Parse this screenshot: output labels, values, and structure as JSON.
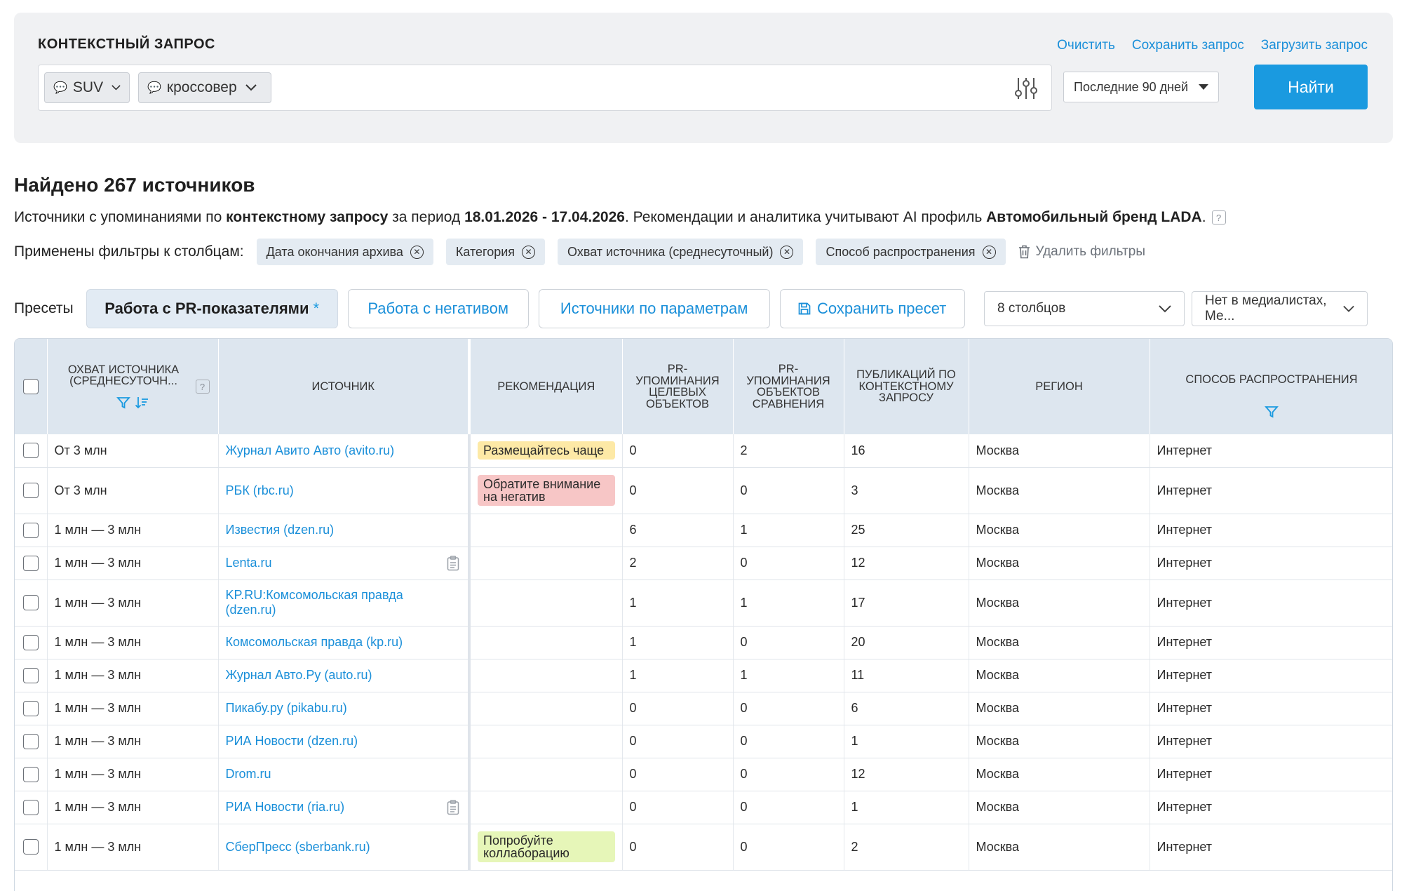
{
  "query": {
    "title": "КОНТЕКСТНЫЙ ЗАПРОС",
    "actions": [
      "Очистить",
      "Сохранить запрос",
      "Загрузить запрос"
    ],
    "chips": [
      "SUV",
      "кроссовер"
    ],
    "period": "Последние 90 дней",
    "find_label": "Найти"
  },
  "results": {
    "title": "Найдено 267 источников",
    "desc_1": "Источники с упоминаниями по ",
    "desc_bold_1": "контекстному запросу",
    "desc_2": " за период ",
    "desc_bold_2": "18.01.2026 - 17.04.2026",
    "desc_3": ". Рекомендации и аналитика учитывают AI профиль ",
    "desc_bold_3": "Автомобильный бренд LADA",
    "desc_4": ".",
    "help": "?",
    "filters_label": "Применены фильтры к столбцам:",
    "filters": [
      "Дата окончания архива",
      "Категория",
      "Охват источника (среднесуточный)",
      "Способ распространения"
    ],
    "delete_filters": "Удалить фильтры"
  },
  "presets": {
    "label": "Пресеты",
    "active": "Работа с PR-показателями",
    "active_mark": "*",
    "items": [
      "Работа с негативом",
      "Источники по параметрам"
    ],
    "save": "Сохранить пресет",
    "columns": "8 столбцов",
    "media": "Нет в медиалистах, Ме..."
  },
  "table": {
    "headers": {
      "reach": "Охват источника (среднесуточн...",
      "source": "Источник",
      "recommendation": "Рекомендация",
      "pr_target": "PR-упоминания целевых объектов",
      "pr_compare": "PR-упоминания объектов сравнения",
      "publications": "Публикаций по контекстному запросу",
      "region": "Регион",
      "distribution": "Способ распространения"
    },
    "rows": [
      {
        "reach": "От 3 млн",
        "source": "Журнал Авито Авто (avito.ru)",
        "rec": "Размещайтесь чаще",
        "rec_color": "yellow",
        "pr_t": "0",
        "pr_c": "2",
        "pub": "16",
        "region": "Москва",
        "dist": "Интернет"
      },
      {
        "reach": "От 3 млн",
        "source": "РБК (rbc.ru)",
        "rec": "Обратите внимание на негатив",
        "rec_color": "red",
        "pr_t": "0",
        "pr_c": "0",
        "pub": "3",
        "region": "Москва",
        "dist": "Интернет"
      },
      {
        "reach": "1 млн — 3 млн",
        "source": "Известия (dzen.ru)",
        "rec": "",
        "pr_t": "6",
        "pr_c": "1",
        "pub": "25",
        "region": "Москва",
        "dist": "Интернет"
      },
      {
        "reach": "1 млн — 3 млн",
        "source": "Lenta.ru",
        "rec": "",
        "pr_t": "2",
        "pr_c": "0",
        "pub": "12",
        "region": "Москва",
        "dist": "Интернет"
      },
      {
        "reach": "1 млн — 3 млн",
        "source": "KP.RU:Комсомольская правда (dzen.ru)",
        "rec": "",
        "pr_t": "1",
        "pr_c": "1",
        "pub": "17",
        "region": "Москва",
        "dist": "Интернет"
      },
      {
        "reach": "1 млн — 3 млн",
        "source": "Комсомольская правда (kp.ru)",
        "rec": "",
        "pr_t": "1",
        "pr_c": "0",
        "pub": "20",
        "region": "Москва",
        "dist": "Интернет"
      },
      {
        "reach": "1 млн — 3 млн",
        "source": "Журнал Авто.Ру (auto.ru)",
        "rec": "",
        "pr_t": "1",
        "pr_c": "1",
        "pub": "11",
        "region": "Москва",
        "dist": "Интернет"
      },
      {
        "reach": "1 млн — 3 млн",
        "source": "Пикабу.ру (pikabu.ru)",
        "rec": "",
        "pr_t": "0",
        "pr_c": "0",
        "pub": "6",
        "region": "Москва",
        "dist": "Интернет"
      },
      {
        "reach": "1 млн — 3 млн",
        "source": "РИА Новости (dzen.ru)",
        "rec": "",
        "pr_t": "0",
        "pr_c": "0",
        "pub": "1",
        "region": "Москва",
        "dist": "Интернет"
      },
      {
        "reach": "1 млн — 3 млн",
        "source": "Drom.ru",
        "rec": "",
        "pr_t": "0",
        "pr_c": "0",
        "pub": "12",
        "region": "Москва",
        "dist": "Интернет"
      },
      {
        "reach": "1 млн — 3 млн",
        "source": "РИА Новости (ria.ru)",
        "rec": "",
        "pr_t": "0",
        "pr_c": "0",
        "pub": "1",
        "region": "Москва",
        "dist": "Интернет"
      },
      {
        "reach": "1 млн — 3 млн",
        "source": "СберПресс (sberbank.ru)",
        "rec": "Попробуйте коллаборацию",
        "rec_color": "green",
        "pr_t": "0",
        "pr_c": "0",
        "pub": "2",
        "region": "Москва",
        "dist": "Интернет"
      }
    ]
  },
  "icons": {
    "chip": "speech-bubble-icon",
    "settings": "sliders-icon",
    "filter": "filter-funnel-icon",
    "sort": "sort-desc-icon",
    "clipboard": "clipboard-icon",
    "trash": "trash-icon",
    "save": "floppy-disk-icon"
  },
  "colors": {
    "accent": "#1a9ae0",
    "link": "#1a8fd9",
    "rec_yellow": "#fde9a6",
    "rec_red": "#f7c6c6",
    "rec_green": "#e6f6b8"
  }
}
